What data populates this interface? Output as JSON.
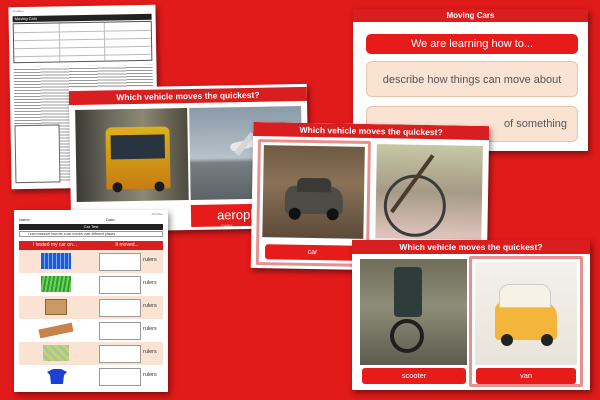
{
  "lesson_plan": {
    "brand": "PlanBee",
    "header": "Moving Cars"
  },
  "objectives_slide": {
    "title": "Moving Cars",
    "subtitle": "We are learning how to...",
    "point_1": "describe how things can move about",
    "point_2_tail": "of something"
  },
  "quickest_bus": {
    "title": "Which vehicle moves the quickest?",
    "caption": "aeropl",
    "brand": "PlanBee"
  },
  "quickest_car": {
    "title": "Which vehicle moves the quickest?",
    "caption": "car"
  },
  "quickest_van": {
    "title": "Which vehicle moves the quickest?",
    "caption_left": "scooter",
    "caption_right": "van"
  },
  "worksheet": {
    "brand": "PlanBee",
    "name_label": "Name:",
    "date_label": "Date:",
    "title": "Car Test",
    "objective": "I can measure how far a car moves over different places",
    "col1": "I tested my car on...",
    "col2": "It moved...",
    "rows": [
      "rulers",
      "rulers",
      "rulers",
      "rulers",
      "rulers",
      "rulers"
    ]
  },
  "colors": {
    "accent": "#d81e1e",
    "background": "#e11a1a",
    "pill": "#fbe3d3"
  }
}
